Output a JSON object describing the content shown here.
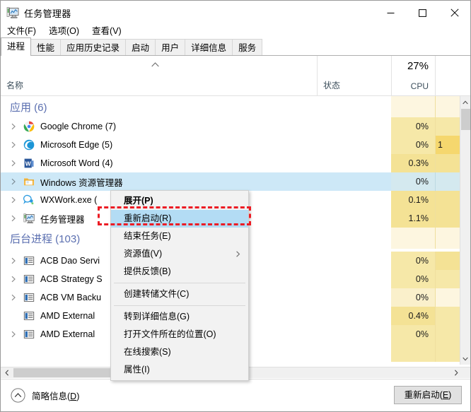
{
  "window": {
    "title": "任务管理器",
    "icon": "task-manager-icon",
    "controls": {
      "minimize": "最小化",
      "maximize": "最大化",
      "close": "关闭"
    }
  },
  "menubar": {
    "items": [
      {
        "label": "文件(F)"
      },
      {
        "label": "选项(O)"
      },
      {
        "label": "查看(V)"
      }
    ]
  },
  "tabs": [
    {
      "label": "进程",
      "active": true
    },
    {
      "label": "性能",
      "active": false
    },
    {
      "label": "应用历史记录",
      "active": false
    },
    {
      "label": "启动",
      "active": false
    },
    {
      "label": "用户",
      "active": false
    },
    {
      "label": "详细信息",
      "active": false
    },
    {
      "label": "服务",
      "active": false
    }
  ],
  "columns": {
    "name": {
      "label": "名称",
      "sorted": true,
      "sort_direction": "asc"
    },
    "status": {
      "label": "状态"
    },
    "cpu": {
      "label": "CPU",
      "total": "27%"
    }
  },
  "list": {
    "groups": [
      {
        "label": "应用 (6)",
        "name": "应用",
        "count": 6,
        "rows": [
          {
            "name": "Google Chrome (7)",
            "icon": "chrome-icon",
            "expandable": true,
            "cpu": "0%",
            "extra": "",
            "selected": false
          },
          {
            "name": "Microsoft Edge (5)",
            "icon": "edge-icon",
            "expandable": true,
            "cpu": "0%",
            "extra": "1",
            "selected": false
          },
          {
            "name": "Microsoft Word (4)",
            "icon": "word-icon",
            "expandable": true,
            "cpu": "0.3%",
            "extra": "",
            "selected": false
          },
          {
            "name": "Windows 资源管理器",
            "icon": "explorer-icon",
            "expandable": true,
            "cpu": "0%",
            "extra": "",
            "selected": true
          },
          {
            "name": "WXWork.exe (",
            "icon": "wxwork-icon",
            "expandable": true,
            "cpu": "0.1%",
            "extra": "",
            "selected": false
          },
          {
            "name": "任务管理器",
            "icon": "task-manager-icon",
            "expandable": true,
            "cpu": "1.1%",
            "extra": "",
            "selected": false
          }
        ]
      },
      {
        "label": "后台进程 (103)",
        "name": "后台进程",
        "count": 103,
        "rows": [
          {
            "name": "ACB Dao Servi",
            "icon": "generic-process-icon",
            "expandable": true,
            "cpu": "0%",
            "extra": "",
            "selected": false
          },
          {
            "name": "ACB Strategy S",
            "icon": "generic-process-icon",
            "expandable": true,
            "cpu": "0%",
            "extra": "",
            "selected": false
          },
          {
            "name": "ACB VM Backu",
            "icon": "generic-process-icon",
            "expandable": true,
            "cpu": "0%",
            "extra": "",
            "selected": false
          },
          {
            "name": "AMD External",
            "icon": "generic-process-icon",
            "expandable": false,
            "cpu": "0.4%",
            "extra": "",
            "selected": false
          },
          {
            "name": "AMD External",
            "icon": "generic-process-icon",
            "expandable": true,
            "cpu": "0%",
            "extra": "",
            "selected": false
          }
        ]
      }
    ]
  },
  "context_menu": {
    "items": [
      {
        "label": "展开(P)",
        "bold": true,
        "highlight": false,
        "submenu": false,
        "separator_after": false
      },
      {
        "label": "重新启动(R)",
        "bold": false,
        "highlight": true,
        "submenu": false,
        "separator_after": false
      },
      {
        "label": "结束任务(E)",
        "bold": false,
        "highlight": false,
        "submenu": false,
        "separator_after": false
      },
      {
        "label": "资源值(V)",
        "bold": false,
        "highlight": false,
        "submenu": true,
        "separator_after": false
      },
      {
        "label": "提供反馈(B)",
        "bold": false,
        "highlight": false,
        "submenu": false,
        "separator_after": true
      },
      {
        "label": "创建转储文件(C)",
        "bold": false,
        "highlight": false,
        "submenu": false,
        "separator_after": true
      },
      {
        "label": "转到详细信息(G)",
        "bold": false,
        "highlight": false,
        "submenu": false,
        "separator_after": false
      },
      {
        "label": "打开文件所在的位置(O)",
        "bold": false,
        "highlight": false,
        "submenu": false,
        "separator_after": false
      },
      {
        "label": "在线搜索(S)",
        "bold": false,
        "highlight": false,
        "submenu": false,
        "separator_after": false
      },
      {
        "label": "属性(I)",
        "bold": false,
        "highlight": false,
        "submenu": false,
        "separator_after": false
      }
    ]
  },
  "annotation": {
    "type": "red-dashed-rectangle",
    "target": "重新启动(R)",
    "color": "#ec1c24"
  },
  "statusbar": {
    "fewer_details_prefix": "简略信息(",
    "fewer_details_key": "D",
    "fewer_details_suffix": ")",
    "restart_prefix": "重新启动(",
    "restart_key": "E",
    "restart_suffix": ")"
  },
  "colors": {
    "selection": "#cde8f7",
    "menu_highlight": "#b3dcf4",
    "group_label": "#5b6fb0",
    "heat_light": "#fdf6e0",
    "heat_mid": "#f6e8a8",
    "heat_strong": "#f5d76e",
    "annotation": "#ec1c24"
  }
}
